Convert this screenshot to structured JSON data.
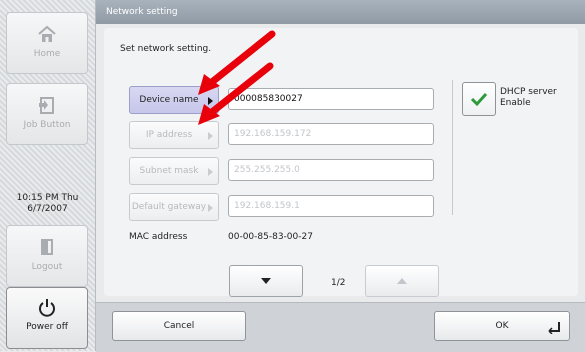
{
  "sidebar": {
    "home_label": "Home",
    "job_label": "Job Button",
    "clock_time": "10:15 PM  Thu",
    "clock_date": "6/7/2007",
    "logout_label": "Logout",
    "power_label": "Power off"
  },
  "window": {
    "title": "Network setting"
  },
  "main": {
    "instruction": "Set network setting.",
    "fields": [
      {
        "label": "Device name",
        "value": "000085830027"
      },
      {
        "label": "IP address",
        "value": "192.168.159.172"
      },
      {
        "label": "Subnet mask",
        "value": "255.255.255.0"
      },
      {
        "label": "Default gateway",
        "value": "192.168.159.1"
      }
    ],
    "dhcp": {
      "line1": "DHCP server",
      "line2": "Enable",
      "checked": true
    },
    "mac": {
      "label": "MAC address",
      "value": "00-00-85-83-00-27"
    },
    "page_indicator": "1/2"
  },
  "footer": {
    "cancel_label": "Cancel",
    "ok_label": "OK"
  },
  "colors": {
    "annotation_arrow": "#e8000b",
    "check": "#2e9a3c",
    "active_button": "#c6c7ea"
  }
}
